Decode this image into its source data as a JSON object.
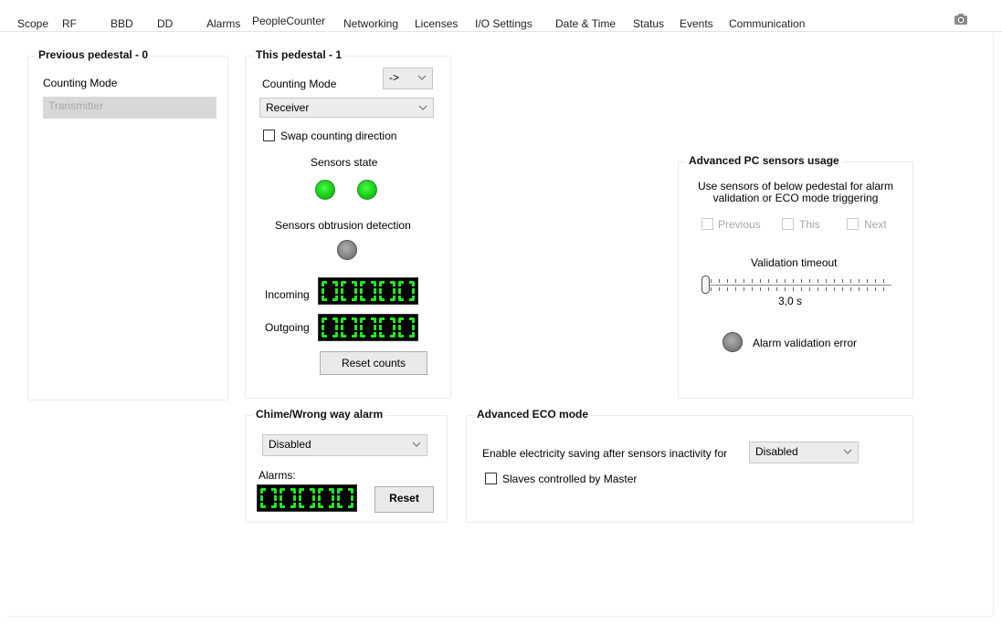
{
  "tabs": [
    {
      "label": "Scope"
    },
    {
      "label": "RF"
    },
    {
      "label": "BBD"
    },
    {
      "label": "DD"
    },
    {
      "label": "Alarms"
    },
    {
      "label": "PeopleCounter",
      "active": true
    },
    {
      "label": "Networking"
    },
    {
      "label": "Licenses"
    },
    {
      "label": "I/O Settings"
    },
    {
      "label": "Date & Time"
    },
    {
      "label": "Status"
    },
    {
      "label": "Events"
    },
    {
      "label": "Communication"
    }
  ],
  "previous_pedestal": {
    "title": "Previous pedestal - 0",
    "counting_mode_label": "Counting Mode",
    "counting_mode_value": "Transmitter"
  },
  "this_pedestal": {
    "title": "This pedestal - 1",
    "direction_value": "->",
    "counting_mode_label": "Counting Mode",
    "counting_mode_value": "Receiver",
    "swap_label": "Swap counting direction",
    "swap_checked": false,
    "sensors_state_label": "Sensors state",
    "sensors_state": [
      "on",
      "on"
    ],
    "obstruction_label": "Sensors obtrusion detection",
    "incoming_label": "Incoming",
    "outgoing_label": "Outgoing",
    "reset_counts_label": "Reset counts"
  },
  "chime": {
    "title": "Chime/Wrong way alarm",
    "mode_value": "Disabled",
    "alarms_label": "Alarms:",
    "reset_label": "Reset"
  },
  "advanced_pc": {
    "title": "Advanced PC sensors usage",
    "description_line1": "Use sensors of below pedestal for alarm",
    "description_line2": "validation or ECO mode triggering",
    "options": [
      {
        "label": "Previous",
        "checked": false
      },
      {
        "label": "This",
        "checked": false
      },
      {
        "label": "Next",
        "checked": false
      }
    ],
    "validation_timeout_label": "Validation timeout",
    "validation_timeout_value": "3,0 s",
    "alarm_validation_error_label": "Alarm validation error"
  },
  "advanced_eco": {
    "title": "Advanced ECO mode",
    "enable_label": "Enable electricity saving after sensors inactivity for",
    "enable_value": "Disabled",
    "slaves_label": "Slaves controlled by Master",
    "slaves_checked": false
  },
  "colors": {
    "led_green": "#22e822",
    "led_gray": "#7a7a7a",
    "counter_bg": "#000000",
    "counter_digit": "#22e822"
  },
  "icons": {
    "combo_arrow": "chevron-down-icon",
    "camera": "camera-icon"
  }
}
